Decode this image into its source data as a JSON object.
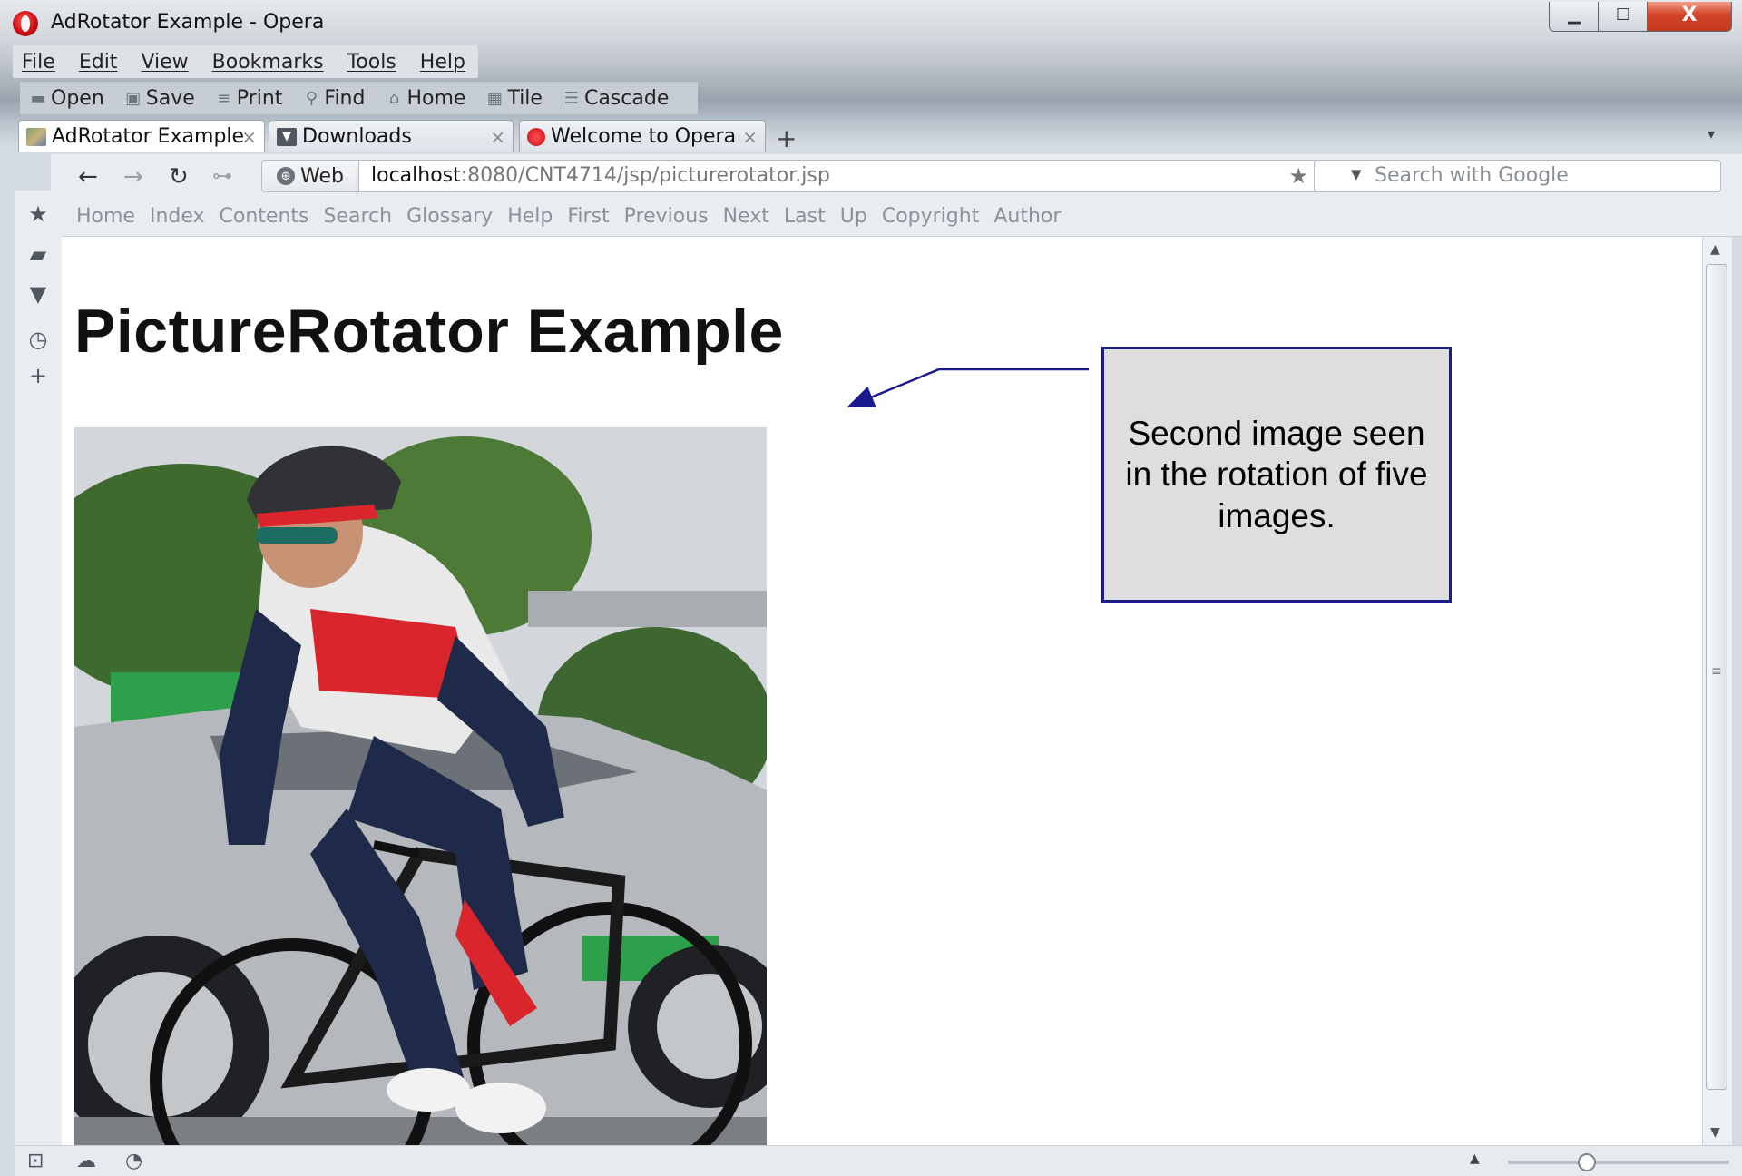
{
  "window": {
    "title": "AdRotator Example - Opera",
    "controls": {
      "minimize": "▁",
      "maximize": "☐",
      "close": "X"
    }
  },
  "menubar": {
    "items": [
      "File",
      "Edit",
      "View",
      "Bookmarks",
      "Tools",
      "Help"
    ]
  },
  "toolbar": {
    "items": [
      {
        "label": "Open",
        "icon": "folder-icon"
      },
      {
        "label": "Save",
        "icon": "save-icon"
      },
      {
        "label": "Print",
        "icon": "print-icon"
      },
      {
        "label": "Find",
        "icon": "find-icon"
      },
      {
        "label": "Home",
        "icon": "home-icon"
      },
      {
        "label": "Tile",
        "icon": "tile-icon"
      },
      {
        "label": "Cascade",
        "icon": "cascade-icon"
      }
    ]
  },
  "tabs": [
    {
      "label": "AdRotator Example",
      "icon": "page-favicon-icon",
      "active": true
    },
    {
      "label": "Downloads",
      "icon": "downloads-icon",
      "active": false
    },
    {
      "label": "Welcome to Opera",
      "icon": "opera-icon",
      "active": false
    }
  ],
  "address": {
    "web_label": "Web",
    "url_host": "localhost",
    "url_rest": ":8080/CNT4714/jsp/picturerotator.jsp",
    "search_placeholder": "Search with Google"
  },
  "navigation_bar": {
    "links": [
      "Home",
      "Index",
      "Contents",
      "Search",
      "Glossary",
      "Help",
      "First",
      "Previous",
      "Next",
      "Last",
      "Up",
      "Copyright",
      "Author"
    ]
  },
  "page": {
    "heading": "PictureRotator Example"
  },
  "callout": {
    "text": "Second image seen in the rotation of five images.",
    "border_color": "#1a1a8c"
  },
  "statusbar": {
    "zoom_level": 0.35
  },
  "colors": {
    "close_button": "#d24428",
    "opera_red": "#cc0f16",
    "nav_link": "#8c929a"
  }
}
